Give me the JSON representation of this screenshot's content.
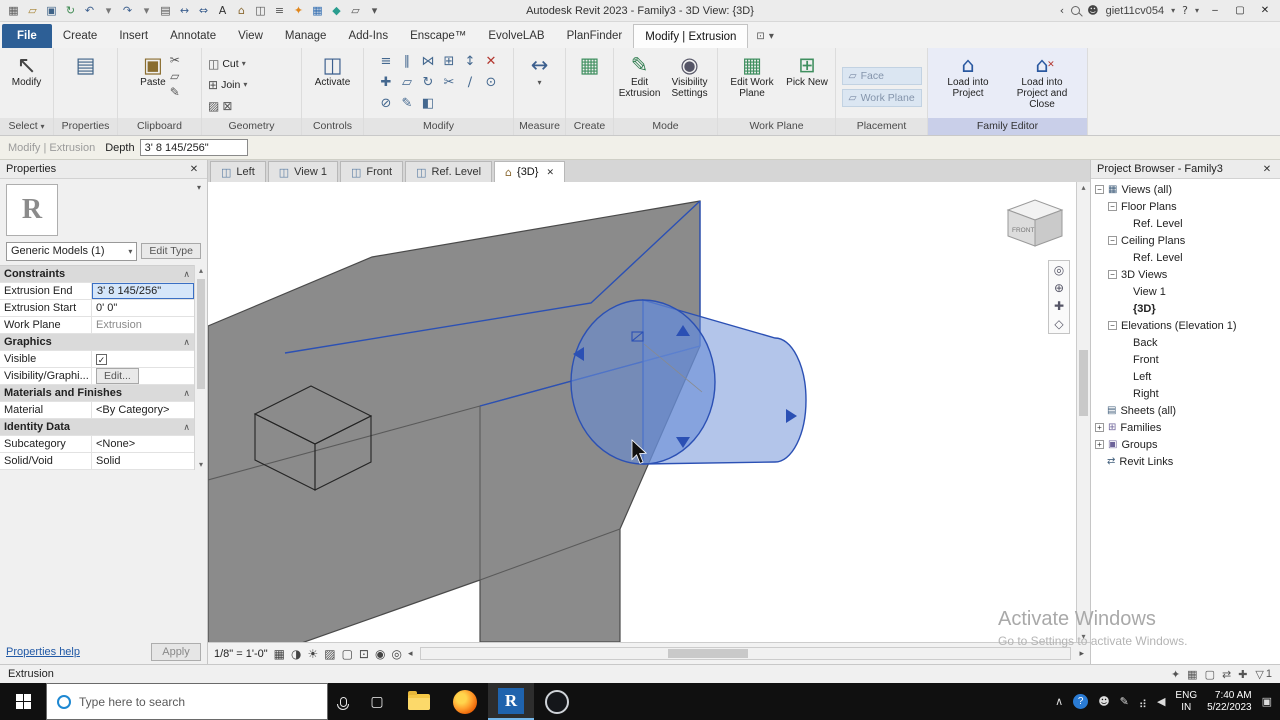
{
  "title_bar": {
    "title": "Autodesk Revit 2023 - Family3 - 3D View: {3D}",
    "user": "giet11cv054"
  },
  "quick_access": [
    "revit-app",
    "open",
    "save",
    "sync",
    "undo",
    "undo-drop",
    "redo",
    "redo-drop",
    "print",
    "measure",
    "dimension",
    "text",
    "default-3d",
    "section",
    "thin-lines",
    "escape-plugin",
    "evolvelab-plugin",
    "planfinder-plugin",
    "switch-windows",
    "qat-customize"
  ],
  "ribbon": {
    "tabs": [
      {
        "label": "File",
        "type": "file"
      },
      {
        "label": "Create"
      },
      {
        "label": "Insert"
      },
      {
        "label": "Annotate"
      },
      {
        "label": "View"
      },
      {
        "label": "Manage"
      },
      {
        "label": "Add-Ins"
      },
      {
        "label": "Enscape™"
      },
      {
        "label": "EvolveLAB"
      },
      {
        "label": "PlanFinder"
      },
      {
        "label": "Modify | Extrusion",
        "type": "active"
      }
    ],
    "panels": {
      "select": {
        "label": "Select",
        "modify": "Modify"
      },
      "properties": {
        "label": "Properties"
      },
      "clipboard": {
        "label": "Clipboard",
        "paste": "Paste"
      },
      "geometry": {
        "label": "Geometry",
        "cut": "Cut",
        "join": "Join"
      },
      "controls": {
        "label": "Controls",
        "activate": "Activate"
      },
      "modify": {
        "label": "Modify"
      },
      "measure": {
        "label": "Measure"
      },
      "create": {
        "label": "Create"
      },
      "mode": {
        "label": "Mode",
        "edit_extrusion": "Edit Extrusion",
        "visibility": "Visibility Settings"
      },
      "work_plane": {
        "label": "Work Plane",
        "edit": "Edit Work Plane",
        "pick": "Pick New"
      },
      "placement": {
        "label": "Placement",
        "face": "Face",
        "work_plane": "Work Plane"
      },
      "family_editor": {
        "label": "Family Editor",
        "load": "Load into Project",
        "load_close": "Load into Project and Close"
      }
    },
    "modify_tools": [
      "align",
      "offset",
      "mirror",
      "array",
      "scale",
      "delete",
      "move",
      "copy",
      "rotate",
      "trim",
      "split",
      "pin",
      "unpin",
      "match",
      "paint"
    ]
  },
  "options_bar": {
    "context": "Modify | Extrusion",
    "depth_label": "Depth",
    "depth_value": "3' 8 145/256\""
  },
  "properties_palette": {
    "title": "Properties",
    "thumbnail_letter": "R",
    "type_selector": "Generic Models (1)",
    "edit_type": "Edit Type",
    "rows": [
      {
        "type": "group",
        "label": "Constraints"
      },
      {
        "type": "value",
        "label": "Extrusion End",
        "value": "3' 8 145/256\"",
        "selected": true
      },
      {
        "type": "value",
        "label": "Extrusion Start",
        "value": "0' 0\""
      },
      {
        "type": "value",
        "label": "Work Plane",
        "value": "Extrusion",
        "dim": true
      },
      {
        "type": "group",
        "label": "Graphics"
      },
      {
        "type": "check",
        "label": "Visible",
        "checked": true
      },
      {
        "type": "button",
        "label": "Visibility/Graphi...",
        "value": "Edit..."
      },
      {
        "type": "group",
        "label": "Materials and Finishes"
      },
      {
        "type": "value",
        "label": "Material",
        "value": "<By Category>"
      },
      {
        "type": "group",
        "label": "Identity Data"
      },
      {
        "type": "value",
        "label": "Subcategory",
        "value": "<None>"
      },
      {
        "type": "value",
        "label": "Solid/Void",
        "value": "Solid"
      }
    ],
    "help_link": "Properties help",
    "apply": "Apply"
  },
  "view_tabs": [
    {
      "label": "Left"
    },
    {
      "label": "View 1"
    },
    {
      "label": "Front"
    },
    {
      "label": "Ref. Level"
    },
    {
      "label": "{3D}",
      "active": true,
      "closable": true
    }
  ],
  "viewport": {
    "viewcube_front": "FRONT"
  },
  "view_control_bar": {
    "scale": "1/8\" = 1'-0\"",
    "icons": [
      "detail-level",
      "visual-style",
      "sun-path",
      "shadows",
      "crop-view",
      "crop-visibility",
      "temporary-hide",
      "reveal-hidden"
    ]
  },
  "project_browser": {
    "title": "Project Browser - Family3",
    "tree": [
      {
        "label": "Views (all)",
        "depth": 0,
        "expand": "minus",
        "icon": "views"
      },
      {
        "label": "Floor Plans",
        "depth": 1,
        "expand": "minus"
      },
      {
        "label": "Ref. Level",
        "depth": 2
      },
      {
        "label": "Ceiling Plans",
        "depth": 1,
        "expand": "minus"
      },
      {
        "label": "Ref. Level",
        "depth": 2
      },
      {
        "label": "3D Views",
        "depth": 1,
        "expand": "minus"
      },
      {
        "label": "View 1",
        "depth": 2
      },
      {
        "label": "{3D}",
        "depth": 2,
        "bold": true
      },
      {
        "label": "Elevations (Elevation 1)",
        "depth": 1,
        "expand": "minus"
      },
      {
        "label": "Back",
        "depth": 2
      },
      {
        "label": "Front",
        "depth": 2
      },
      {
        "label": "Left",
        "depth": 2
      },
      {
        "label": "Right",
        "depth": 2
      },
      {
        "label": "Sheets (all)",
        "depth": 0,
        "icon": "sheets"
      },
      {
        "label": "Families",
        "depth": 0,
        "expand": "plus",
        "icon": "families"
      },
      {
        "label": "Groups",
        "depth": 0,
        "expand": "plus",
        "icon": "groups"
      },
      {
        "label": "Revit Links",
        "depth": 0,
        "icon": "links"
      }
    ]
  },
  "status_bar": {
    "message": "Extrusion",
    "selection_count": "1",
    "icons": [
      "worksharing",
      "design-options",
      "editable-only",
      "links-select",
      "pins-select"
    ]
  },
  "watermark": {
    "line1": "Activate Windows",
    "line2": "Go to Settings to activate Windows."
  },
  "taskbar": {
    "search_placeholder": "Type here to search",
    "apps": [
      "file-explorer",
      "firefox",
      "revit",
      "obs"
    ],
    "active_app": "revit",
    "tray": [
      "tray-expand",
      "help",
      "people",
      "pen",
      "network",
      "volume"
    ],
    "language": "ENG",
    "region": "IN",
    "time": "7:40 AM",
    "date": "5/22/2023"
  }
}
